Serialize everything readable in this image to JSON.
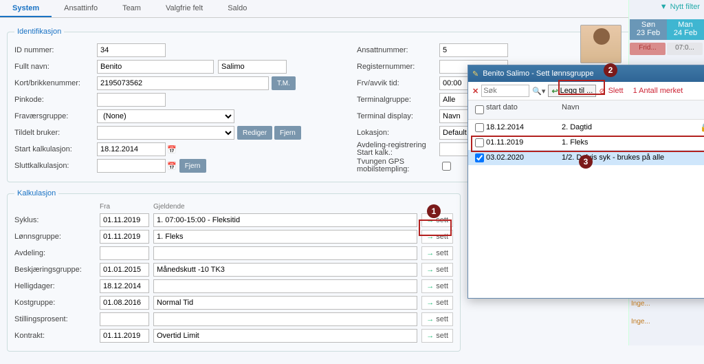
{
  "tabs": [
    "System",
    "Ansattinfo",
    "Team",
    "Valgfrie felt",
    "Saldo"
  ],
  "filter_btn": "Nytt filter",
  "days": [
    {
      "dow": "Søn",
      "date": "23 Feb"
    },
    {
      "dow": "Man",
      "date": "24 Feb"
    }
  ],
  "chips": {
    "frid": "Frid...",
    "time": "07:0..."
  },
  "ident": {
    "legend": "Identifikasjon",
    "labels": {
      "id": "ID nummer:",
      "navn": "Fullt navn:",
      "kort": "Kort/brikkenummer:",
      "pin": "Pinkode:",
      "frav": "Fraværsgruppe:",
      "tildelt": "Tildelt bruker:",
      "startk": "Start kalkulasjon:",
      "sluttk": "Sluttkalkulasjon:",
      "ansatt": "Ansattnummer:",
      "reg": "Registernummer:",
      "frv": "Frv/avvik tid:",
      "term": "Terminalgruppe:",
      "termd": "Terminal display:",
      "lok": "Lokasjon:",
      "avdreg": "Avdeling-registrering Start kalk.:",
      "tvgps": "Tvungen GPS mobilstempling:"
    },
    "values": {
      "id": "34",
      "first": "Benito",
      "last": "Salimo",
      "kort": "2195073562",
      "pin": "",
      "frav": "(None)",
      "tildelt": "",
      "startk": "18.12.2014",
      "sluttk": "",
      "ansatt": "5",
      "reg": "",
      "frv": "00:00",
      "term": "Alle",
      "termd": "Navn",
      "lok": "Default",
      "avdreg": ""
    },
    "buttons": {
      "tm": "T.M.",
      "rediger": "Rediger",
      "fjern": "Fjern",
      "fjer": "Fjer"
    }
  },
  "kalk": {
    "legend": "Kalkulasjon",
    "headers": {
      "fra": "Fra",
      "gjeld": "Gjeldende"
    },
    "sett": "sett",
    "rows": [
      {
        "label": "Syklus:",
        "fra": "01.11.2019",
        "gjeld": "1. 07:00-15:00 - Fleksitid",
        "name": "syklus"
      },
      {
        "label": "Lønnsgruppe:",
        "fra": "01.11.2019",
        "gjeld": "1. Fleks",
        "name": "lonnsgruppe"
      },
      {
        "label": "Avdeling:",
        "fra": "",
        "gjeld": "",
        "name": "avdeling"
      },
      {
        "label": "Beskjæringsgruppe:",
        "fra": "01.01.2015",
        "gjeld": "Månedskutt -10 TK3",
        "name": "beskjaering"
      },
      {
        "label": "Helligdager:",
        "fra": "18.12.2014",
        "gjeld": "",
        "name": "helligdager"
      },
      {
        "label": "Kostgruppe:",
        "fra": "01.08.2016",
        "gjeld": "Normal Tid",
        "name": "kostgruppe"
      },
      {
        "label": "Stillingsprosent:",
        "fra": "",
        "gjeld": "",
        "name": "stillingsprosent"
      },
      {
        "label": "Kontrakt:",
        "fra": "01.11.2019",
        "gjeld": "Overtid Limit",
        "name": "kontrakt"
      }
    ]
  },
  "modal": {
    "title": "Benito Salimo - Sett lønnsgruppe",
    "search_placeholder": "Søk",
    "legg": "Legg til ...",
    "slett": "Slett",
    "antall": "1 Antall merket",
    "th": {
      "start": "start dato",
      "navn": "Navn"
    },
    "rows": [
      {
        "date": "18.12.2014",
        "navn": "2. Dagtid",
        "checked": false,
        "lock": true
      },
      {
        "date": "01.11.2019",
        "navn": "1. Fleks",
        "checked": false,
        "lock": false
      },
      {
        "date": "03.02.2020",
        "navn": "1/2. Delvis syk - brukes på alle",
        "checked": true,
        "lock": false
      }
    ]
  },
  "callouts": {
    "b1": "1",
    "b2": "2",
    "b3": "3"
  },
  "inge": "Inge..."
}
